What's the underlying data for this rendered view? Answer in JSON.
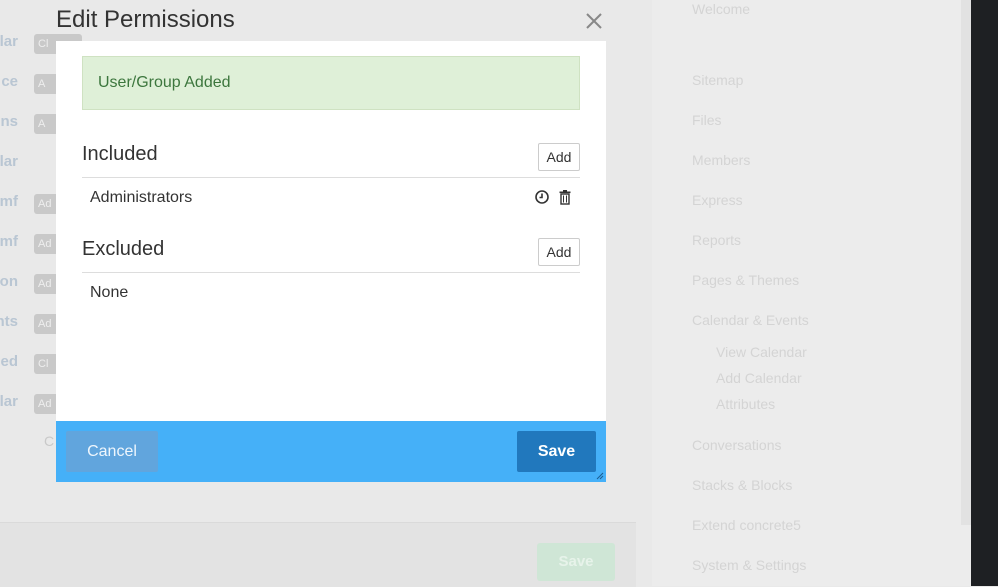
{
  "background": {
    "rows": [
      {
        "label": "lar",
        "badge": "Cl"
      },
      {
        "label": "ce",
        "badge": "A"
      },
      {
        "label": "ns",
        "badge": "A"
      },
      {
        "label": "lar",
        "badge": ""
      },
      {
        "label": "mf",
        "badge": "Ad"
      },
      {
        "label": "mf",
        "badge": "Ad"
      },
      {
        "label": "on",
        "badge": "Ad"
      },
      {
        "label": "nts",
        "badge": "Ad"
      },
      {
        "label": "ed",
        "badge": "Cl"
      },
      {
        "label": "lar",
        "badge": "Ad"
      }
    ],
    "cancel_label": "C",
    "save_label": "Save",
    "nav": {
      "welcome": "Welcome",
      "sitemap": "Sitemap",
      "files": "Files",
      "members": "Members",
      "express": "Express",
      "reports": "Reports",
      "pages_themes": "Pages & Themes",
      "calendar_events": "Calendar & Events",
      "view_calendar": "View Calendar",
      "add_calendar": "Add Calendar",
      "attributes": "Attributes",
      "conversations": "Conversations",
      "stacks_blocks": "Stacks & Blocks",
      "extend": "Extend concrete5",
      "system_settings": "System & Settings"
    }
  },
  "dialog": {
    "title": "Edit Permissions",
    "alert": "User/Group Added",
    "included": {
      "title": "Included",
      "add_label": "Add",
      "entries": [
        "Administrators"
      ]
    },
    "excluded": {
      "title": "Excluded",
      "add_label": "Add",
      "empty_text": "None"
    },
    "footer": {
      "cancel_label": "Cancel",
      "save_label": "Save"
    }
  },
  "colors": {
    "footer_bg": "#45b0f8",
    "save_bg": "#2178bd",
    "alert_bg": "#dff0d8",
    "alert_text": "#3c763d"
  }
}
